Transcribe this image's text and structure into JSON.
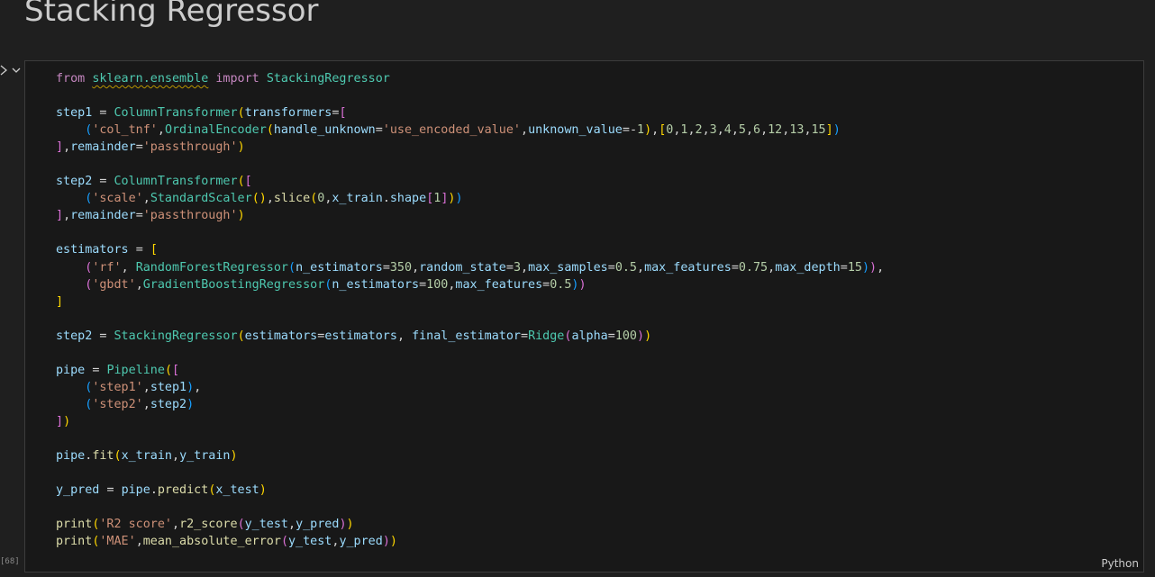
{
  "heading": "Stacking Regressor",
  "cell": {
    "execution_count": "[68]",
    "language": "Python",
    "run_toggle_icon": "chevron-right-icon",
    "collapse_icon": "chevron-down-icon",
    "code_lines": [
      "from sklearn.ensemble import StackingRegressor",
      "",
      "step1 = ColumnTransformer(transformers=[",
      "    ('col_tnf',OrdinalEncoder(handle_unknown='use_encoded_value',unknown_value=-1),[0,1,2,3,4,5,6,12,13,15])",
      "],remainder='passthrough')",
      "",
      "step2 = ColumnTransformer([",
      "    ('scale',StandardScaler(),slice(0,x_train.shape[1]))",
      "],remainder='passthrough')",
      "",
      "estimators = [",
      "    ('rf', RandomForestRegressor(n_estimators=350,random_state=3,max_samples=0.5,max_features=0.75,max_depth=15)),",
      "    ('gbdt',GradientBoostingRegressor(n_estimators=100,max_features=0.5))",
      "]",
      "",
      "step2 = StackingRegressor(estimators=estimators, final_estimator=Ridge(alpha=100))",
      "",
      "pipe = Pipeline([",
      "    ('step1',step1),",
      "    ('step2',step2)",
      "])",
      "",
      "pipe.fit(x_train,y_train)",
      "",
      "y_pred = pipe.predict(x_test)",
      "",
      "print('R2 score',r2_score(y_test,y_pred))",
      "print('MAE',mean_absolute_error(y_test,y_pred))"
    ]
  },
  "syntax_colors": {
    "text": "#cccccc",
    "keyword": "#c586c0",
    "class": "#4ec9b0",
    "function": "#dcdcaa",
    "variable": "#9cdcfe",
    "string": "#ce9178",
    "number": "#b5cea8",
    "bracket_1": "#ffd700",
    "bracket_2": "#da70d6",
    "bracket_3": "#179fff",
    "warning_underline": "#b89500"
  }
}
